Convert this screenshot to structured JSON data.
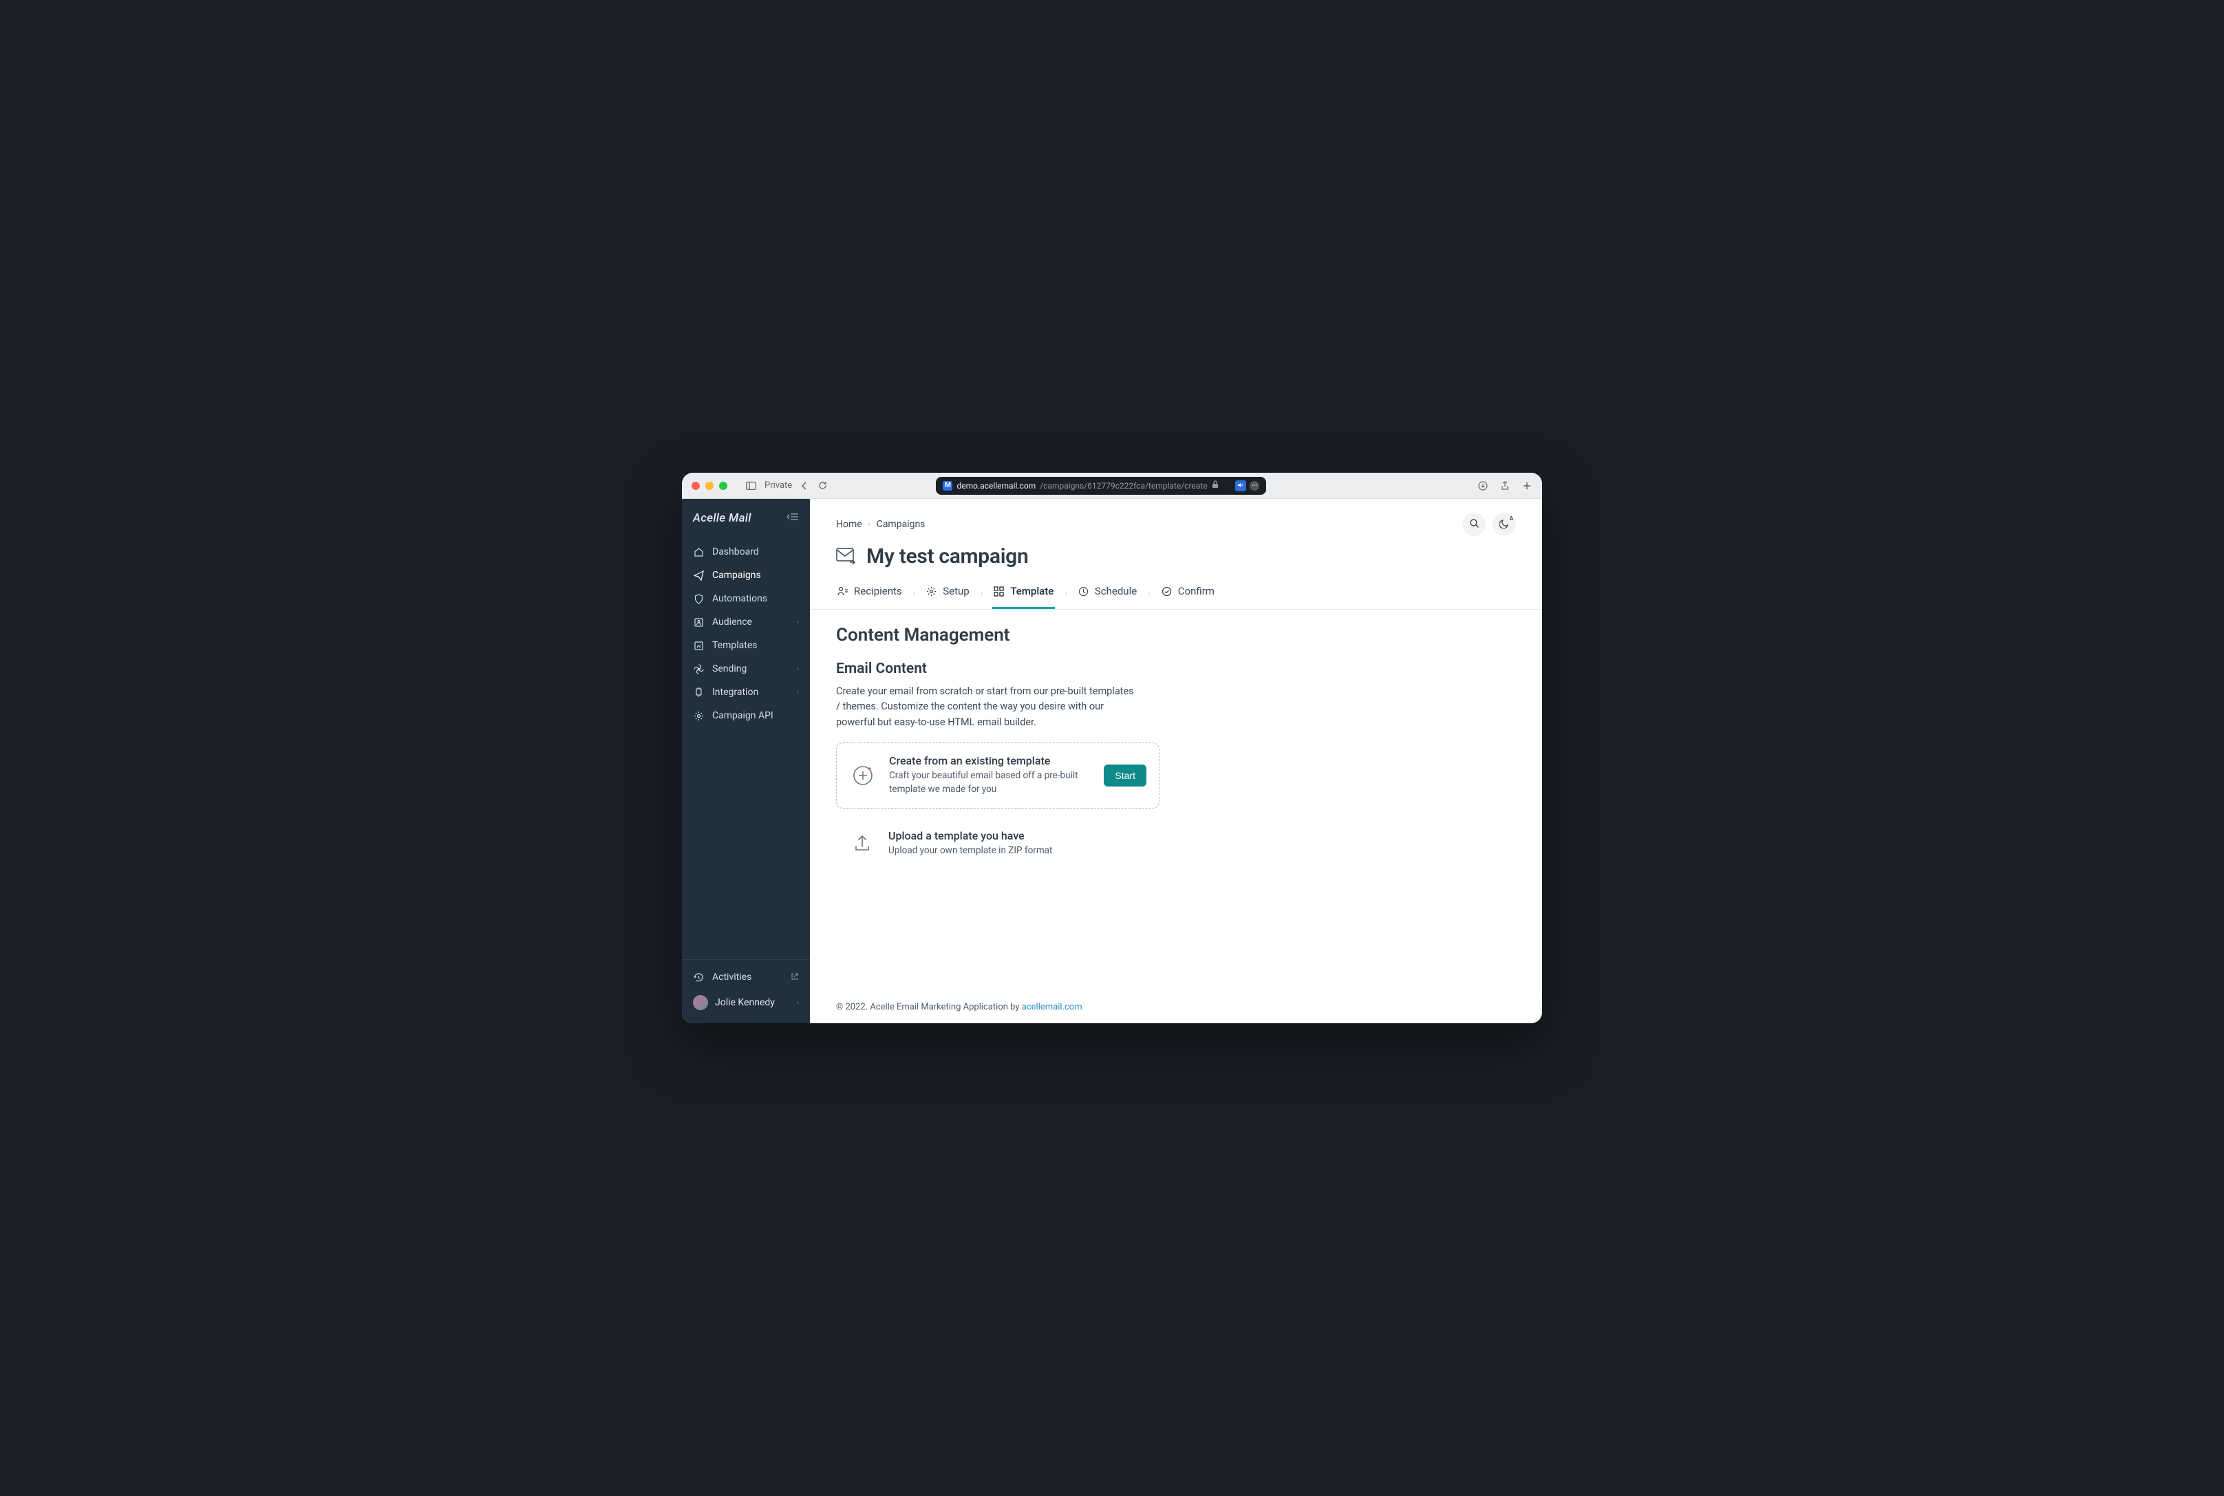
{
  "browser": {
    "label_private": "Private",
    "url_host": "demo.acellemail.com",
    "url_path": "/campaigns/612779c222fca/template/create"
  },
  "brand": {
    "name": "Acelle Mail"
  },
  "sidebar": {
    "items": [
      {
        "label": "Dashboard",
        "icon": "home",
        "expandable": false
      },
      {
        "label": "Campaigns",
        "icon": "send",
        "active": true,
        "expandable": false
      },
      {
        "label": "Automations",
        "icon": "shield",
        "expandable": false
      },
      {
        "label": "Audience",
        "icon": "users",
        "expandable": true
      },
      {
        "label": "Templates",
        "icon": "template",
        "expandable": false
      },
      {
        "label": "Sending",
        "icon": "fan",
        "expandable": true
      },
      {
        "label": "Integration",
        "icon": "plug",
        "expandable": true
      },
      {
        "label": "Campaign API",
        "icon": "gear",
        "expandable": false
      }
    ],
    "activities": "Activities",
    "user": "Jolie Kennedy"
  },
  "breadcrumbs": {
    "home": "Home",
    "campaigns": "Campaigns"
  },
  "page_title": "My test campaign",
  "steps": {
    "recipients": "Recipients",
    "setup": "Setup",
    "template": "Template",
    "schedule": "Schedule",
    "confirm": "Confirm"
  },
  "content": {
    "heading": "Content Management",
    "subheading": "Email Content",
    "lead": "Create your email from scratch or start from our pre-built templates / themes. Customize the content the way you desire with our powerful but easy-to-use HTML email builder.",
    "option1": {
      "title": "Create from an existing template",
      "desc": "Craft your beautiful email based off a pre-built template we made for you",
      "cta": "Start"
    },
    "option2": {
      "title": "Upload a template you have",
      "desc": "Upload your own template in ZIP format"
    }
  },
  "footer": {
    "prefix": "© 2022. Acelle Email Marketing Application by ",
    "link": "acellemail.com"
  },
  "theme_auto": "A"
}
